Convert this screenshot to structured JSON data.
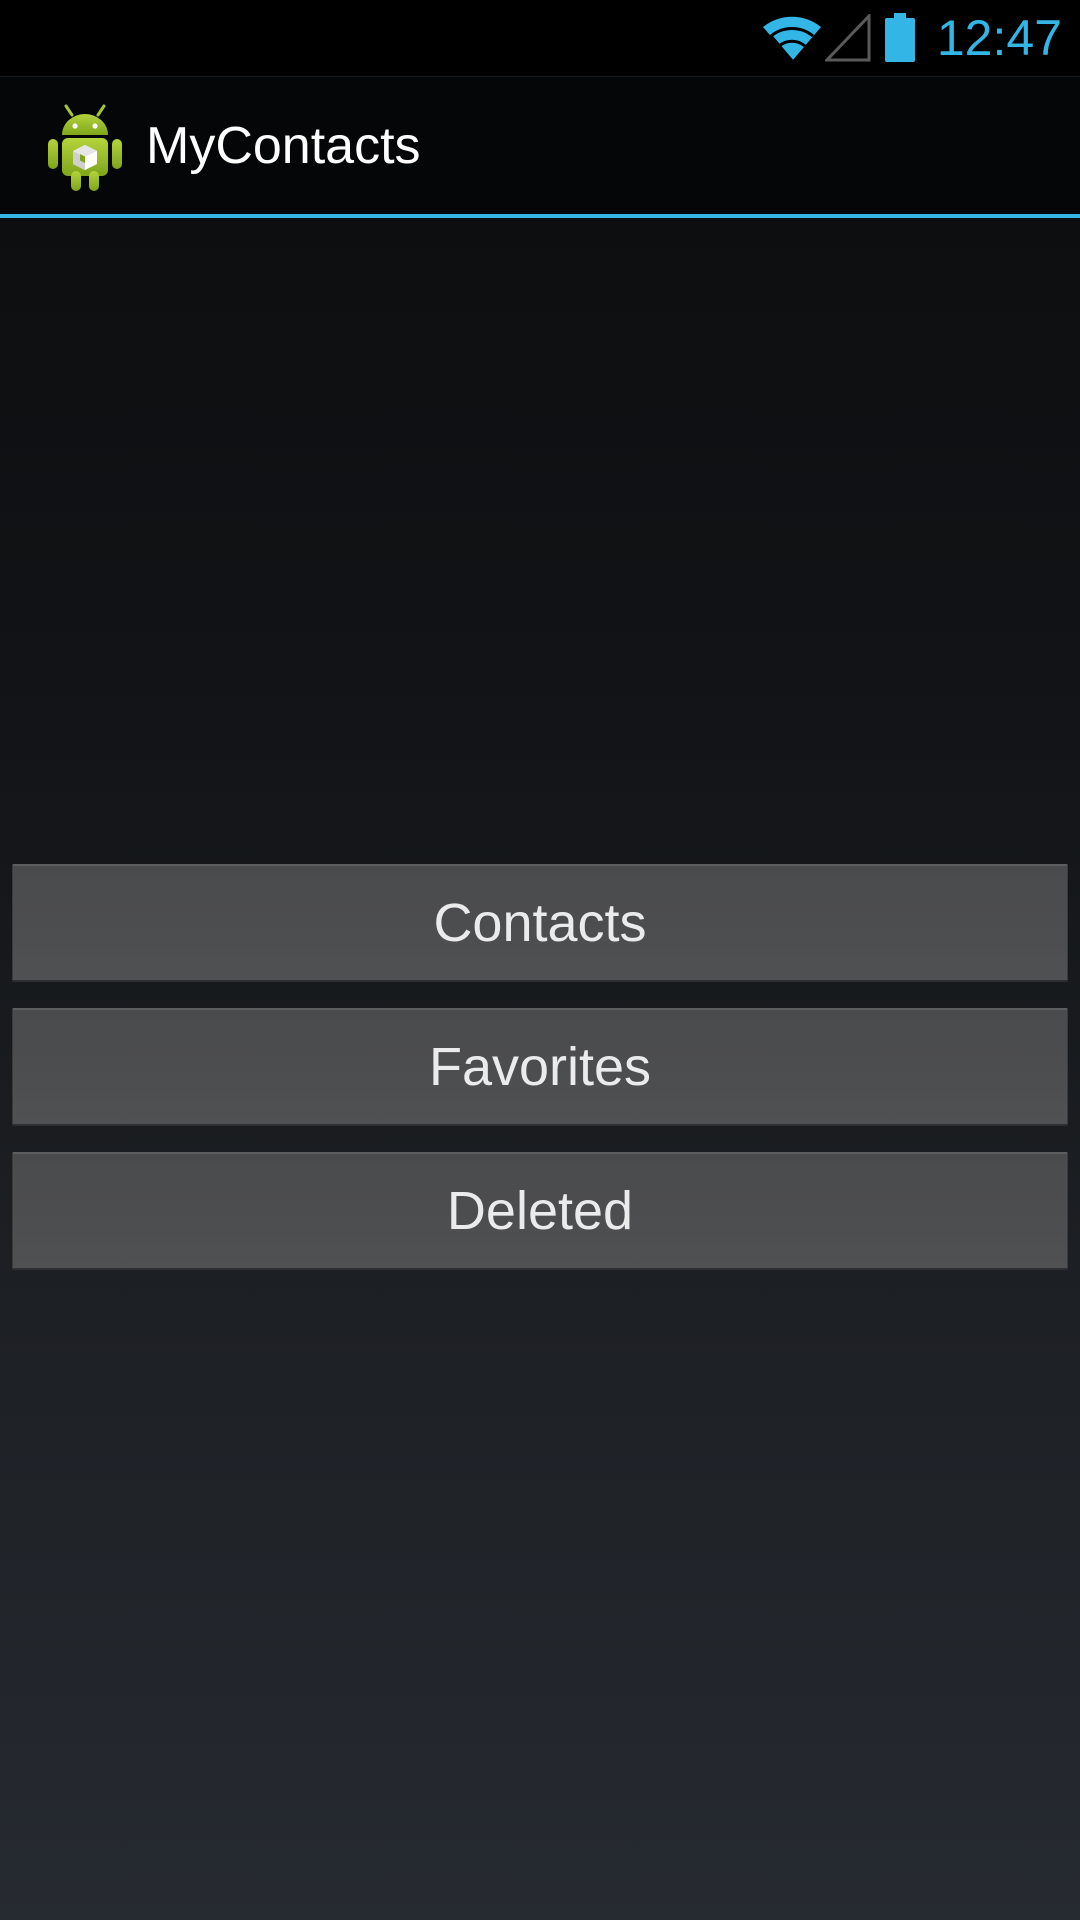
{
  "status_bar": {
    "time": "12:47",
    "icons": [
      "wifi-icon",
      "signal-icon",
      "battery-icon"
    ],
    "accent_color": "#33b5e5"
  },
  "action_bar": {
    "app_icon": "android-app-icon",
    "title": "MyContacts",
    "divider_color": "#33b5e5"
  },
  "main": {
    "buttons": [
      {
        "label": "Contacts"
      },
      {
        "label": "Favorites"
      },
      {
        "label": "Deleted"
      }
    ]
  }
}
